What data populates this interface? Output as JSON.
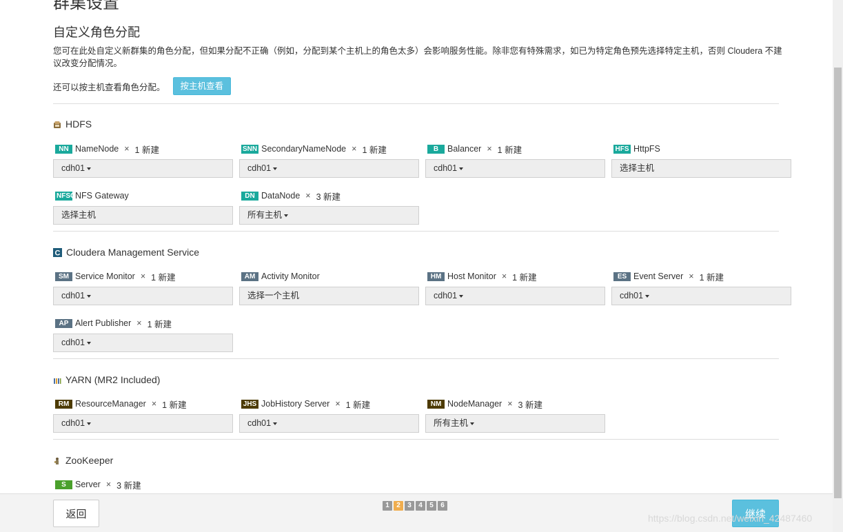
{
  "page": {
    "title": "群集设置",
    "subtitle": "自定义角色分配",
    "description": "您可在此处自定义新群集的角色分配，但如果分配不正确（例如，分配到某个主机上的角色太多）会影响服务性能。除非您有特殊需求，如已为特定角色预先选择特定主机，否则 Cloudera 不建议改变分配情况。",
    "host_view_text": "还可以按主机查看角色分配。",
    "host_view_button": "按主机查看"
  },
  "services": [
    {
      "name": "HDFS",
      "icon": "hdfs-icon",
      "roles": [
        {
          "badge": "NN",
          "name": "NameNode",
          "count": "1 新建",
          "value": "cdh01",
          "dropdown": true
        },
        {
          "badge": "SNN",
          "name": "SecondaryNameNode",
          "count": "1 新建",
          "value": "cdh01",
          "dropdown": true
        },
        {
          "badge": "B",
          "name": "Balancer",
          "count": "1 新建",
          "value": "cdh01",
          "dropdown": true
        },
        {
          "badge": "HFS",
          "name": "HttpFS",
          "count": "",
          "value": "选择主机",
          "dropdown": false
        },
        {
          "badge": "NFSG",
          "name": "NFS Gateway",
          "count": "",
          "value": "选择主机",
          "dropdown": false
        },
        {
          "badge": "DN",
          "name": "DataNode",
          "count": "3 新建",
          "value": "所有主机",
          "dropdown": true
        }
      ]
    },
    {
      "name": "Cloudera Management Service",
      "icon": "cloudera-icon",
      "roles": [
        {
          "badge": "SM",
          "name": "Service Monitor",
          "count": "1 新建",
          "value": "cdh01",
          "dropdown": true
        },
        {
          "badge": "AM",
          "name": "Activity Monitor",
          "count": "",
          "value": "选择一个主机",
          "dropdown": false
        },
        {
          "badge": "HM",
          "name": "Host Monitor",
          "count": "1 新建",
          "value": "cdh01",
          "dropdown": true
        },
        {
          "badge": "ES",
          "name": "Event Server",
          "count": "1 新建",
          "value": "cdh01",
          "dropdown": true
        },
        {
          "badge": "AP",
          "name": "Alert Publisher",
          "count": "1 新建",
          "value": "cdh01",
          "dropdown": true
        }
      ]
    },
    {
      "name": "YARN (MR2 Included)",
      "icon": "yarn-icon",
      "roles": [
        {
          "badge": "RM",
          "name": "ResourceManager",
          "count": "1 新建",
          "value": "cdh01",
          "dropdown": true
        },
        {
          "badge": "JHS",
          "name": "JobHistory Server",
          "count": "1 新建",
          "value": "cdh01",
          "dropdown": true
        },
        {
          "badge": "NM",
          "name": "NodeManager",
          "count": "3 新建",
          "value": "所有主机",
          "dropdown": true
        }
      ]
    },
    {
      "name": "ZooKeeper",
      "icon": "zookeeper-icon",
      "roles": [
        {
          "badge": "S",
          "name": "Server",
          "count": "3 新建",
          "value": "",
          "dropdown": false
        }
      ]
    }
  ],
  "colors": {
    "hdfs_badge": "#1aa99c",
    "mgmt_badge": "#5b7284",
    "yarn_badge": "#4d3b00",
    "zk_badge": "#4aa02c",
    "accent": "#5bc0de",
    "active_step": "#f0ad4e"
  },
  "footer": {
    "back": "返回",
    "continue": "继续",
    "steps": [
      "1",
      "2",
      "3",
      "4",
      "5",
      "6"
    ],
    "active_step": "2"
  },
  "watermark": "https://blog.csdn.net/weixin_42487460"
}
